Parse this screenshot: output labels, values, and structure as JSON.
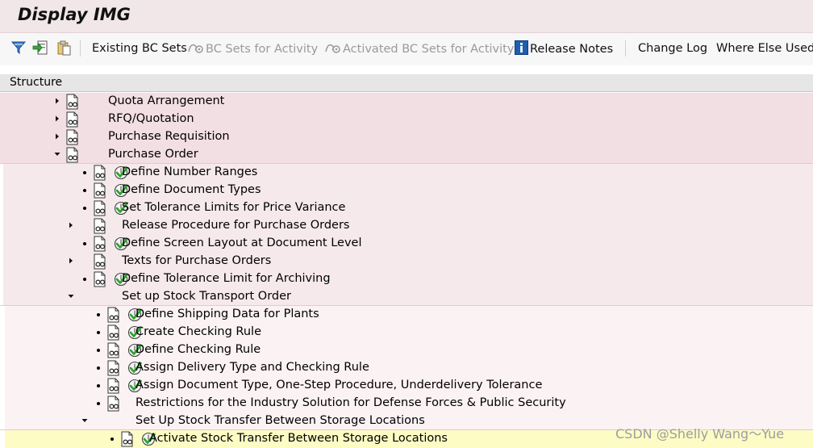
{
  "window": {
    "title": "Display IMG"
  },
  "toolbar": {
    "existing_bc_sets": "Existing BC Sets",
    "bc_sets_for_activity": "BC Sets for Activity",
    "activated_bc_sets": "Activated BC Sets for Activity",
    "release_notes": "Release Notes",
    "change_log": "Change Log",
    "where_else_used": "Where Else Used"
  },
  "structure": {
    "header": "Structure",
    "rows": [
      {
        "label": "Quota Arrangement",
        "expand": "collapsed",
        "has_activity": false
      },
      {
        "label": "RFQ/Quotation",
        "expand": "collapsed",
        "has_activity": false
      },
      {
        "label": "Purchase Requisition",
        "expand": "collapsed",
        "has_activity": false
      },
      {
        "label": "Purchase Order",
        "expand": "expanded",
        "has_activity": false
      },
      {
        "label": "Define Number Ranges",
        "expand": "leaf",
        "has_activity": true
      },
      {
        "label": "Define Document Types",
        "expand": "leaf",
        "has_activity": true
      },
      {
        "label": "Set Tolerance Limits for Price Variance",
        "expand": "leaf",
        "has_activity": true
      },
      {
        "label": "Release Procedure for Purchase Orders",
        "expand": "collapsed",
        "has_activity": false
      },
      {
        "label": "Define Screen Layout at Document Level",
        "expand": "leaf",
        "has_activity": true
      },
      {
        "label": "Texts for Purchase Orders",
        "expand": "collapsed",
        "has_activity": false
      },
      {
        "label": "Define Tolerance Limit for Archiving",
        "expand": "leaf",
        "has_activity": true
      },
      {
        "label": "Set up Stock Transport Order",
        "expand": "expanded",
        "has_activity": false
      },
      {
        "label": "Define Shipping Data for Plants",
        "expand": "leaf",
        "has_activity": true
      },
      {
        "label": "Create Checking Rule",
        "expand": "leaf",
        "has_activity": true
      },
      {
        "label": "Define Checking Rule",
        "expand": "leaf",
        "has_activity": true
      },
      {
        "label": "Assign Delivery Type and Checking Rule",
        "expand": "leaf",
        "has_activity": true
      },
      {
        "label": "Assign Document Type, One-Step Procedure, Underdelivery Tolerance",
        "expand": "leaf",
        "has_activity": true
      },
      {
        "label": "Restrictions for the Industry Solution for Defense Forces & Public Security",
        "expand": "leaf",
        "has_activity": false
      },
      {
        "label": "Set Up Stock Transfer Between Storage Locations",
        "expand": "expanded",
        "has_activity": false
      },
      {
        "label": "Activate Stock Transfer Between Storage Locations",
        "expand": "leaf",
        "has_activity": true,
        "selected": true
      }
    ]
  },
  "watermark": "CSDN @Shelly Wang～Yue"
}
